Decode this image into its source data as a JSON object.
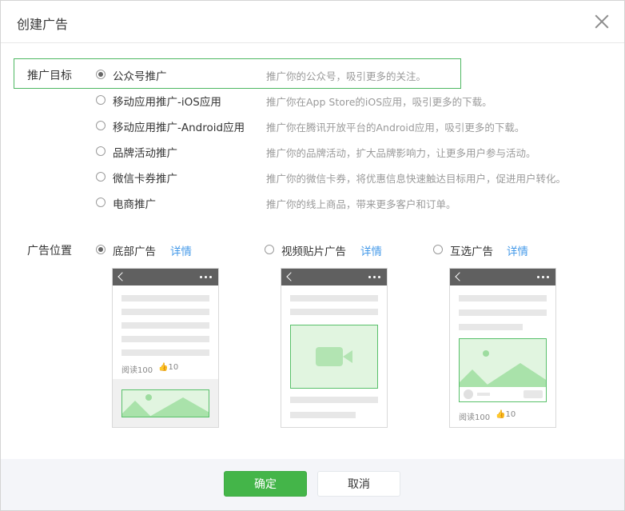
{
  "dialog": {
    "title": "创建广告"
  },
  "objective": {
    "label": "推广目标",
    "options": [
      {
        "label": "公众号推广",
        "desc": "推广你的公众号，吸引更多的关注。",
        "checked": true
      },
      {
        "label": "移动应用推广-iOS应用",
        "desc": "推广你在App Store的iOS应用，吸引更多的下载。",
        "checked": false
      },
      {
        "label": "移动应用推广-Android应用",
        "desc": "推广你在腾讯开放平台的Android应用，吸引更多的下载。",
        "checked": false
      },
      {
        "label": "品牌活动推广",
        "desc": "推广你的品牌活动，扩大品牌影响力，让更多用户参与活动。",
        "checked": false
      },
      {
        "label": "微信卡券推广",
        "desc": "推广你的微信卡券，将优惠信息快速触达目标用户，促进用户转化。",
        "checked": false
      },
      {
        "label": "电商推广",
        "desc": "推广你的线上商品，带来更多客户和订单。",
        "checked": false
      }
    ]
  },
  "placement": {
    "label": "广告位置",
    "options": [
      {
        "label": "底部广告",
        "link": "详情",
        "checked": true
      },
      {
        "label": "视频贴片广告",
        "link": "详情",
        "checked": false
      },
      {
        "label": "互选广告",
        "link": "详情",
        "checked": false
      }
    ],
    "preview_meta": {
      "reads": "阅读100",
      "likes": "10"
    }
  },
  "footer": {
    "confirm": "确定",
    "cancel": "取消"
  },
  "colors": {
    "accent": "#44b549",
    "link": "#459ae9",
    "highlight_border": "#4eb862"
  }
}
